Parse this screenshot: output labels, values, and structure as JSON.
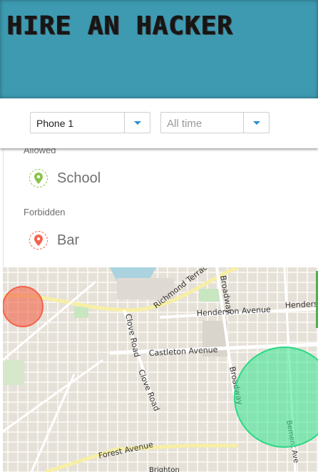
{
  "brand": {
    "title": "HIRE AN HACKER"
  },
  "filters": {
    "device": {
      "value": "Phone 1"
    },
    "range": {
      "placeholder": "All time"
    }
  },
  "places": {
    "allowed_label": "Allowed",
    "allowed": [
      {
        "name": "School",
        "icon": "map-pin-icon",
        "color": "#8bc34a"
      }
    ],
    "forbidden_label": "Forbidden",
    "forbidden": [
      {
        "name": "Bar",
        "icon": "map-pin-icon",
        "color": "#f4624a"
      }
    ]
  },
  "map": {
    "streets": [
      "Richmond Terrace",
      "Broadway",
      "Henderson Avenue",
      "Henders",
      "Clove Road",
      "Castleton Avenue",
      "Broadway",
      "Clove Road",
      "Forest Avenue",
      "Bement Ave",
      "Brighton"
    ],
    "zones": [
      {
        "kind": "forbidden",
        "color": "#f4624a"
      },
      {
        "kind": "allowed",
        "color": "#33e58f"
      }
    ]
  }
}
